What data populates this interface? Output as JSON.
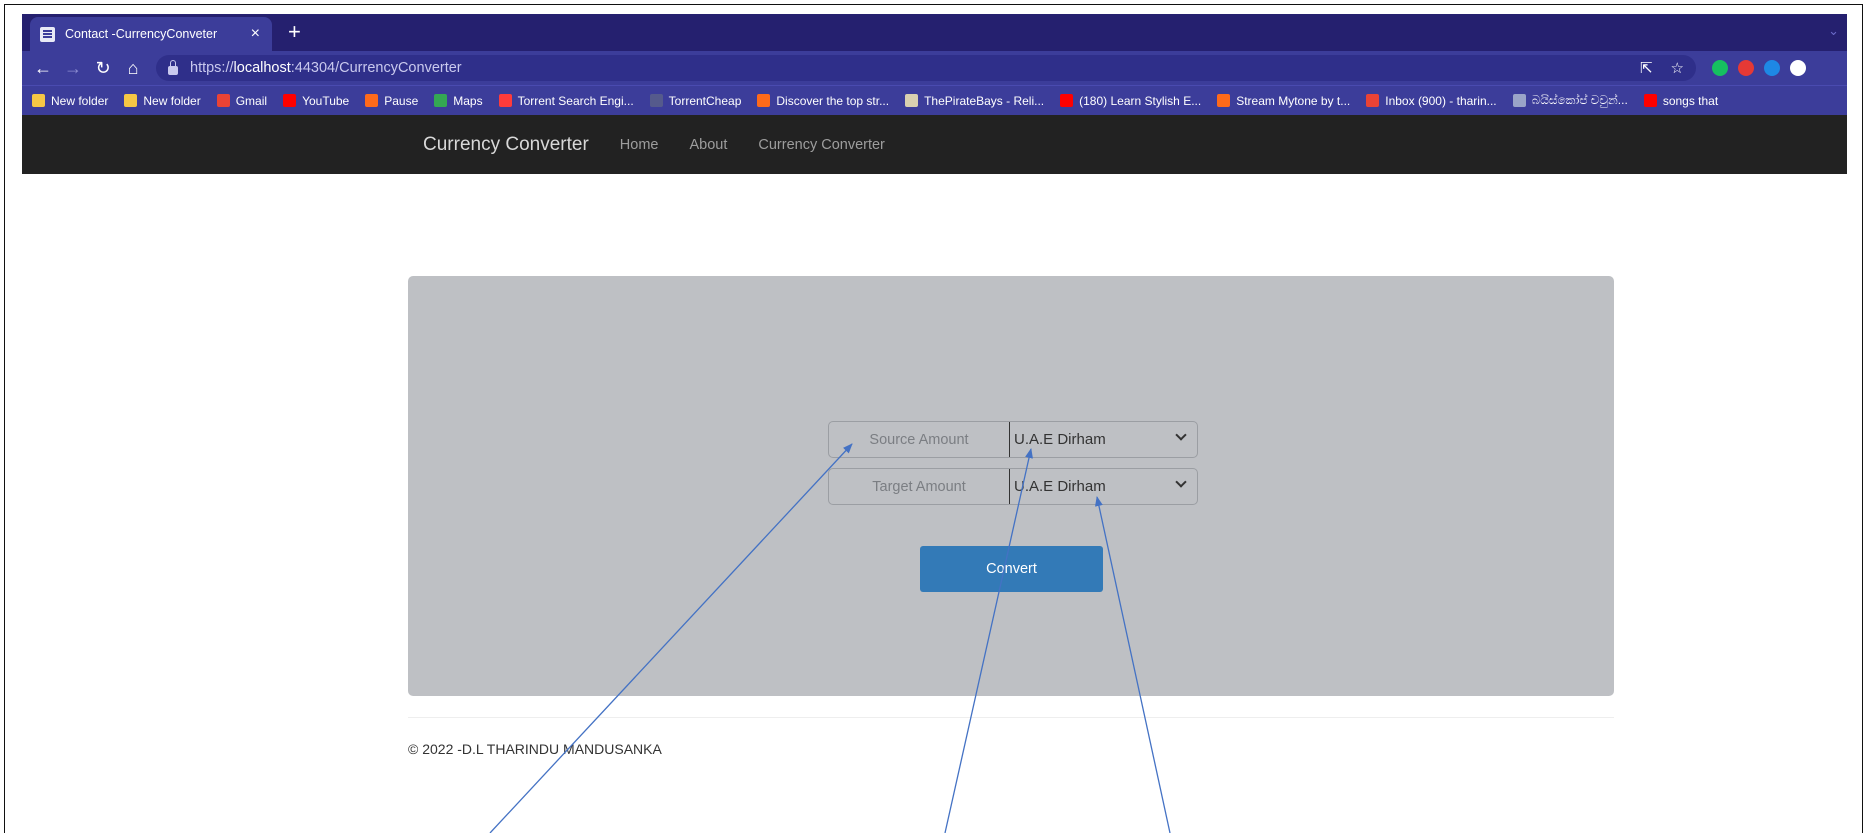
{
  "browser": {
    "tab_title": "Contact -CurrencyConveter",
    "tab_close": "×",
    "new_tab": "+",
    "url_scheme": "https://",
    "url_host": "localhost",
    "url_rest": ":44304/CurrencyConverter",
    "bookmarks": [
      {
        "label": "New folder",
        "color": "#f6c745"
      },
      {
        "label": "New folder",
        "color": "#f6c745"
      },
      {
        "label": "Gmail",
        "color": "#ea4335"
      },
      {
        "label": "YouTube",
        "color": "#ff0000"
      },
      {
        "label": "Pause",
        "color": "#ff6a1a"
      },
      {
        "label": "Maps",
        "color": "#34a853"
      },
      {
        "label": "Torrent Search Engi...",
        "color": "#ff3b3b"
      },
      {
        "label": "TorrentCheap",
        "color": "#555a8c"
      },
      {
        "label": "Discover the top str...",
        "color": "#ff6a1a"
      },
      {
        "label": "ThePirateBays - Reli...",
        "color": "#d9d0b0"
      },
      {
        "label": "(180) Learn Stylish E...",
        "color": "#ff0000"
      },
      {
        "label": "Stream Mytone by t...",
        "color": "#ff6a1a"
      },
      {
        "label": "Inbox (900) - tharin...",
        "color": "#ea4335"
      },
      {
        "label": "බයිස්කෝප් චවුන්...",
        "color": "#9aa4c8"
      },
      {
        "label": "songs that",
        "color": "#ff0000"
      }
    ],
    "extension_colors": [
      "#16c060",
      "#e53935",
      "#1e88e5",
      "#ffffff"
    ]
  },
  "site_nav": {
    "brand": "Currency Converter",
    "links": [
      "Home",
      "About",
      "Currency Converter"
    ]
  },
  "converter": {
    "source_label": "Source Amount",
    "source_currency": "U.A.E Dirham",
    "target_label": "Target Amount",
    "target_currency": "U.A.E Dirham",
    "convert_label": "Convert"
  },
  "footer": {
    "text": "© 2022 -D.L THARINDU MANDUSANKA"
  },
  "colors": {
    "annotation_arrow": "#4472c4",
    "primary_button": "#337ab7",
    "navbar": "#222222",
    "panel": "#bec0c4"
  }
}
